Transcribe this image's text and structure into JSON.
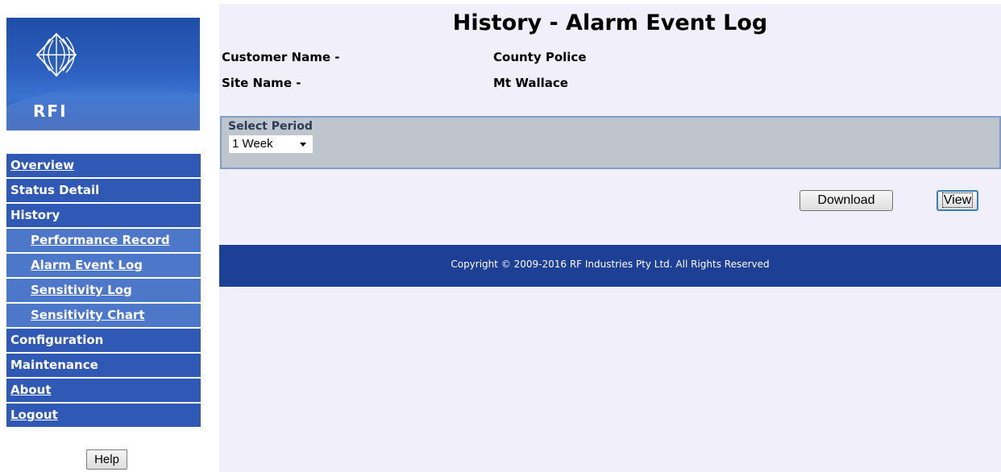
{
  "logo": {
    "text": "RFI"
  },
  "nav": {
    "items": [
      {
        "label": "Overview"
      },
      {
        "label": "Status Detail"
      },
      {
        "label": "History"
      },
      {
        "label": "Performance Record"
      },
      {
        "label": "Alarm Event Log"
      },
      {
        "label": "Sensitivity Log"
      },
      {
        "label": "Sensitivity Chart"
      },
      {
        "label": "Configuration"
      },
      {
        "label": "Maintenance"
      },
      {
        "label": "About"
      },
      {
        "label": "Logout"
      }
    ],
    "help_label": "Help"
  },
  "main": {
    "title": "History - Alarm Event Log",
    "customer_label": "Customer Name -",
    "customer_value": "County Police",
    "site_label": "Site Name -",
    "site_value": "Mt Wallace",
    "period": {
      "label": "Select Period",
      "selected": "1 Week"
    },
    "download_label": "Download",
    "view_label": "View",
    "footer": "Copyright © 2009-2016 RF Industries Pty Ltd. All Rights Reserved"
  },
  "colors": {
    "nav": "#2f59b5",
    "nav_sub": "#4d77c9",
    "footer": "#1d3f96",
    "content_bg": "#f1eff9",
    "period_box": "#bec5cd"
  }
}
